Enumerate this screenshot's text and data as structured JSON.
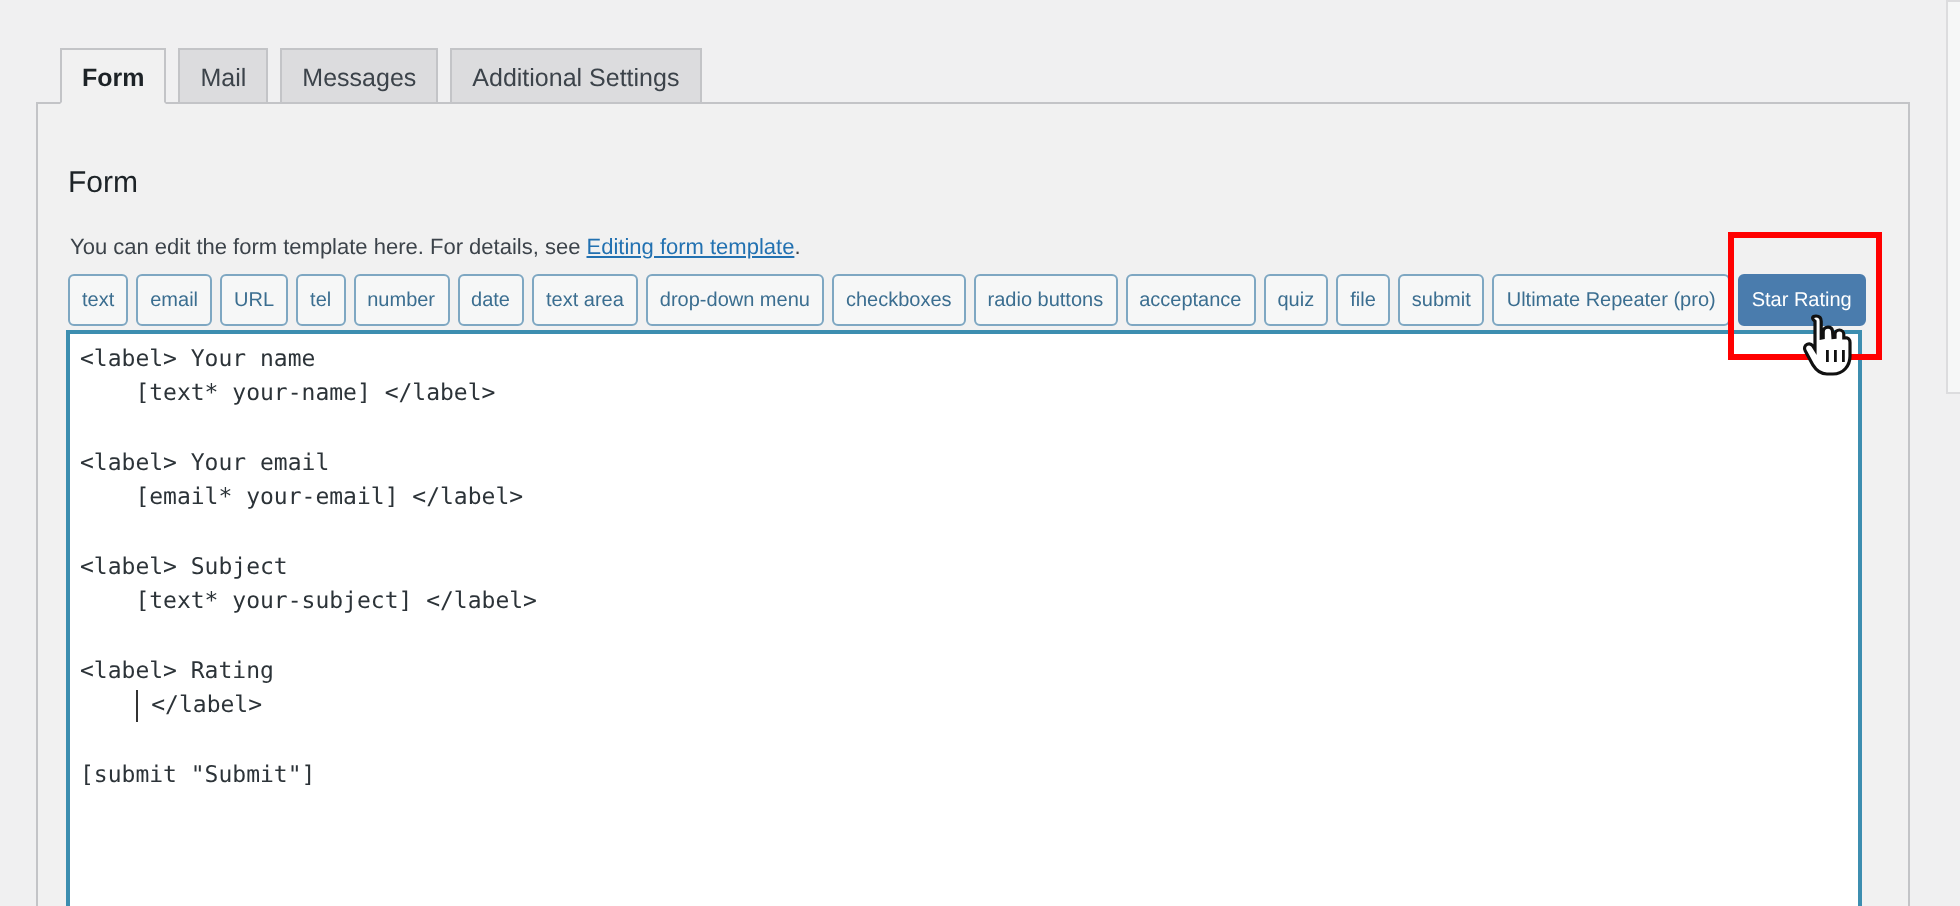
{
  "tabs": [
    {
      "label": "Form",
      "selected": true
    },
    {
      "label": "Mail",
      "selected": false
    },
    {
      "label": "Messages",
      "selected": false
    },
    {
      "label": "Additional Settings",
      "selected": false
    }
  ],
  "panel": {
    "heading": "Form",
    "description": {
      "text": "You can edit the form template here. For details, see",
      "link": "Editing form template",
      "end": "."
    },
    "tag_buttons": [
      {
        "label": "text",
        "selected": false
      },
      {
        "label": "email",
        "selected": false
      },
      {
        "label": "URL",
        "selected": false
      },
      {
        "label": "tel",
        "selected": false
      },
      {
        "label": "number",
        "selected": false
      },
      {
        "label": "date",
        "selected": false
      },
      {
        "label": "text area",
        "selected": false
      },
      {
        "label": "drop-down menu",
        "selected": false
      },
      {
        "label": "checkboxes",
        "selected": false
      },
      {
        "label": "radio buttons",
        "selected": false
      },
      {
        "label": "acceptance",
        "selected": false
      },
      {
        "label": "quiz",
        "selected": false
      },
      {
        "label": "file",
        "selected": false
      },
      {
        "label": "submit",
        "selected": false
      },
      {
        "label": "Ultimate Repeater (pro)",
        "selected": false
      },
      {
        "label": "Star Rating",
        "selected": true,
        "highlighted": true
      }
    ],
    "template_lines": [
      {
        "text": "<label> Your name",
        "cursor": false
      },
      {
        "text": "    [text* your-name] </label>",
        "cursor": false
      },
      {
        "cursor": false
      },
      {
        "text": "<label> Your email",
        "cursor": false
      },
      {
        "text": "    [email* your-email] </label>",
        "cursor": false
      },
      {
        "cursor": false
      },
      {
        "text": "<label> Subject",
        "cursor": false
      },
      {
        "text": "    [text* your-subject] </label>",
        "cursor": false
      },
      {
        "cursor": false
      },
      {
        "text": "<label> Rating",
        "cursor": false
      },
      {
        "text": "    </label>",
        "cursor": true
      },
      {
        "cursor": false
      },
      {
        "text": "[submit \"Submit\"]",
        "cursor": false
      }
    ]
  }
}
